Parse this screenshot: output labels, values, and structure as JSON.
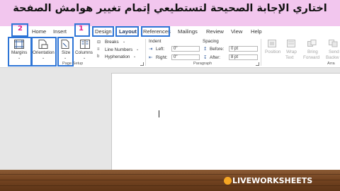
{
  "banner": {
    "question": "اختاري الإجابة الصحيحة لتستطيعي إتمام تغيير هوامش الصفحة"
  },
  "numbers": {
    "one": "1",
    "two": "2"
  },
  "tabs": [
    {
      "label": "Home"
    },
    {
      "label": "Insert"
    },
    {
      "label": "Design"
    },
    {
      "label": "Layout"
    },
    {
      "label": "References"
    },
    {
      "label": "Mailings"
    },
    {
      "label": "Review"
    },
    {
      "label": "View"
    },
    {
      "label": "Help"
    }
  ],
  "page_setup": {
    "margins": "Margins",
    "orientation": "Orientation",
    "size": "Size",
    "columns": "Columns",
    "breaks": "Breaks",
    "line_numbers": "Line Numbers",
    "hyphenation": "Hyphenation",
    "group_name": "Page Setup"
  },
  "paragraph": {
    "indent_heading": "Indent",
    "spacing_heading": "Spacing",
    "left_label": "Left:",
    "left_value": "0\"",
    "right_label": "Right:",
    "right_value": "0\"",
    "before_label": "Before:",
    "before_value": "0 pt",
    "after_label": "After:",
    "after_value": "8 pt",
    "group_name": "Paragraph"
  },
  "arrange": {
    "position": "Position",
    "wrap_text_1": "Wrap",
    "wrap_text_2": "Text",
    "bring_forward_1": "Bring",
    "bring_forward_2": "Forward",
    "send_backward_1": "Send",
    "send_backward_2": "Backw",
    "group_name": "Arra"
  },
  "watermark": {
    "text": "LIVEWORKSHEETS"
  },
  "colors": {
    "highlight_box": "#2e75d6",
    "number": "#e0218a",
    "banner": "#f2c6ee",
    "word_blue": "#2b579a"
  }
}
